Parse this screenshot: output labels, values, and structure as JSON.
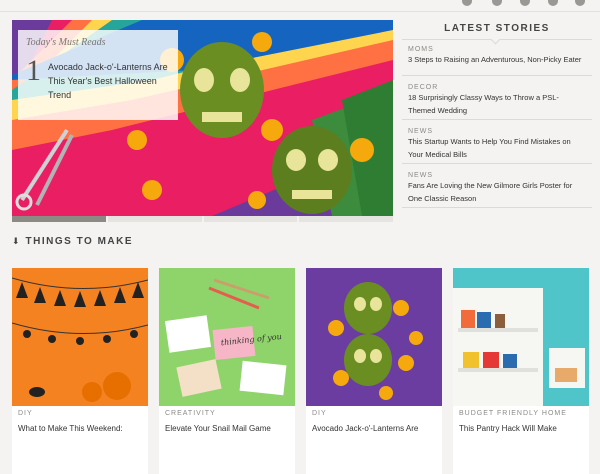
{
  "hero": {
    "kicker": "Today's Must Reads",
    "number": "1",
    "title": "Avocado Jack-o'-Lanterns Are This Year's Best Halloween Trend",
    "slide_count": 4,
    "active_slide": 1
  },
  "latest": {
    "heading": "LATEST STORIES",
    "items": [
      {
        "category": "MOMS",
        "title": "3 Steps to Raising an Adventurous, Non-Picky Eater"
      },
      {
        "category": "DECOR",
        "title": "18 Surprisingly Classy Ways to Throw a PSL-Themed Wedding"
      },
      {
        "category": "NEWS",
        "title": "This Startup Wants to Help You Find Mistakes on Your Medical Bills"
      },
      {
        "category": "NEWS",
        "title": "Fans Are Loving the New Gilmore Girls Poster for One Classic Reason"
      }
    ]
  },
  "things": {
    "heading": "THINGS TO MAKE",
    "pin_icon": "pin-icon",
    "cards": [
      {
        "category": "DIY",
        "title": "What to Make This Weekend:"
      },
      {
        "category": "CREATIVITY",
        "title": "Elevate Your Snail Mail Game"
      },
      {
        "category": "DIY",
        "title": "Avocado Jack-o'-Lanterns Are"
      },
      {
        "category": "BUDGET FRIENDLY HOME",
        "title": "This Pantry Hack Will Make"
      }
    ]
  },
  "card_art": {
    "card1_text": "thinking of you"
  },
  "colors": {
    "background": "#f4f3f1",
    "text": "#333333",
    "muted": "#8c8a86",
    "divider": "#dcdad6"
  }
}
